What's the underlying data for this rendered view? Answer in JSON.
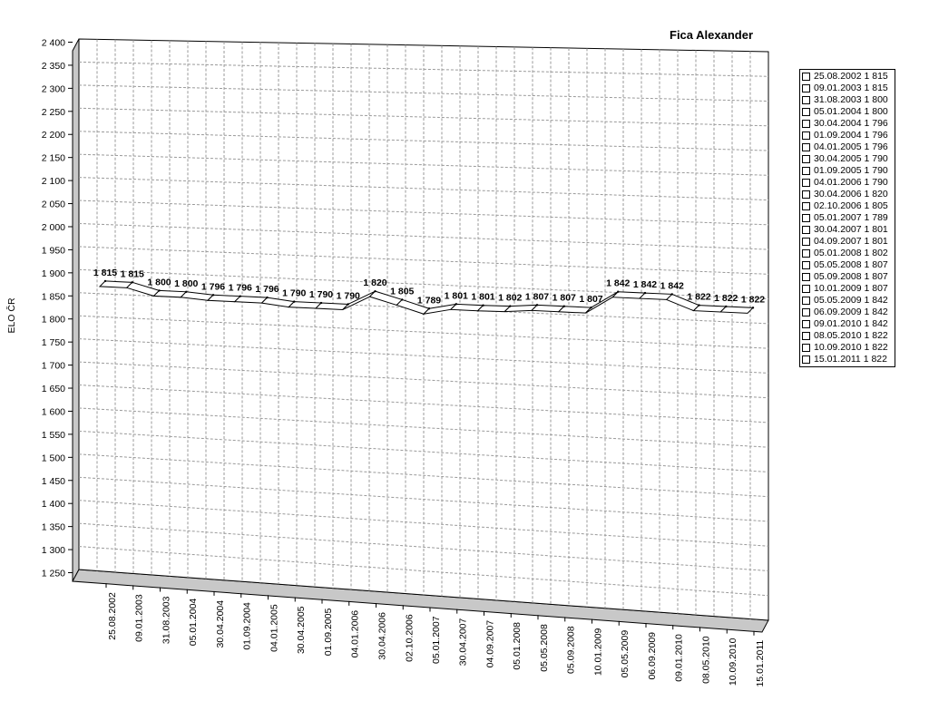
{
  "chart_data": {
    "type": "line",
    "title": "Fica Alexander",
    "ylabel": "ELO ČR",
    "xlabel": "",
    "ylim": [
      1250,
      2400
    ],
    "yticks": [
      "2 400",
      "2 350",
      "2 300",
      "2 250",
      "2 200",
      "2 150",
      "2 100",
      "2 050",
      "2 000",
      "1 950",
      "1 900",
      "1 850",
      "1 800",
      "1 750",
      "1 700",
      "1 650",
      "1 600",
      "1 550",
      "1 500",
      "1 450",
      "1 400",
      "1 350",
      "1 300",
      "1 250"
    ],
    "categories": [
      "25.08.2002",
      "09.01.2003",
      "31.08.2003",
      "05.01.2004",
      "30.04.2004",
      "01.09.2004",
      "04.01.2005",
      "30.04.2005",
      "01.09.2005",
      "04.01.2006",
      "30.04.2006",
      "02.10.2006",
      "05.01.2007",
      "30.04.2007",
      "04.09.2007",
      "05.01.2008",
      "05.05.2008",
      "05.09.2008",
      "10.01.2009",
      "05.05.2009",
      "06.09.2009",
      "09.01.2010",
      "08.05.2010",
      "10.09.2010",
      "15.01.2011"
    ],
    "values": [
      1815,
      1815,
      1800,
      1800,
      1796,
      1796,
      1796,
      1790,
      1790,
      1790,
      1820,
      1805,
      1789,
      1801,
      1801,
      1802,
      1807,
      1807,
      1807,
      1842,
      1842,
      1842,
      1822,
      1822,
      1822
    ],
    "value_labels": [
      "1 815",
      "1 815",
      "1 800",
      "1 800",
      "1 796",
      "1 796",
      "1 796",
      "1 790",
      "1 790",
      "1 790",
      "1 820",
      "1 805",
      "1 789",
      "1 801",
      "1 801",
      "1 802",
      "1 807",
      "1 807",
      "1 807",
      "1 842",
      "1 842",
      "1 842",
      "1 822",
      "1 822",
      "1 822"
    ],
    "legend": [
      "25.08.2002 1 815",
      "09.01.2003 1 815",
      "31.08.2003 1 800",
      "05.01.2004 1 800",
      "30.04.2004 1 796",
      "01.09.2004 1 796",
      "04.01.2005 1 796",
      "30.04.2005 1 790",
      "01.09.2005 1 790",
      "04.01.2006 1 790",
      "30.04.2006 1 820",
      "02.10.2006 1 805",
      "05.01.2007 1 789",
      "30.04.2007 1 801",
      "04.09.2007 1 801",
      "05.01.2008 1 802",
      "05.05.2008 1 807",
      "05.09.2008 1 807",
      "10.01.2009 1 807",
      "05.05.2009 1 842",
      "06.09.2009 1 842",
      "09.01.2010 1 842",
      "08.05.2010 1 822",
      "10.09.2010 1 822",
      "15.01.2011 1 822"
    ],
    "legend_position": "right",
    "grid": true,
    "colors": {
      "line": "#000000",
      "ribbon": "#ffffff",
      "wall": "#c8c8c8",
      "grid": "#9a9a9a"
    }
  }
}
